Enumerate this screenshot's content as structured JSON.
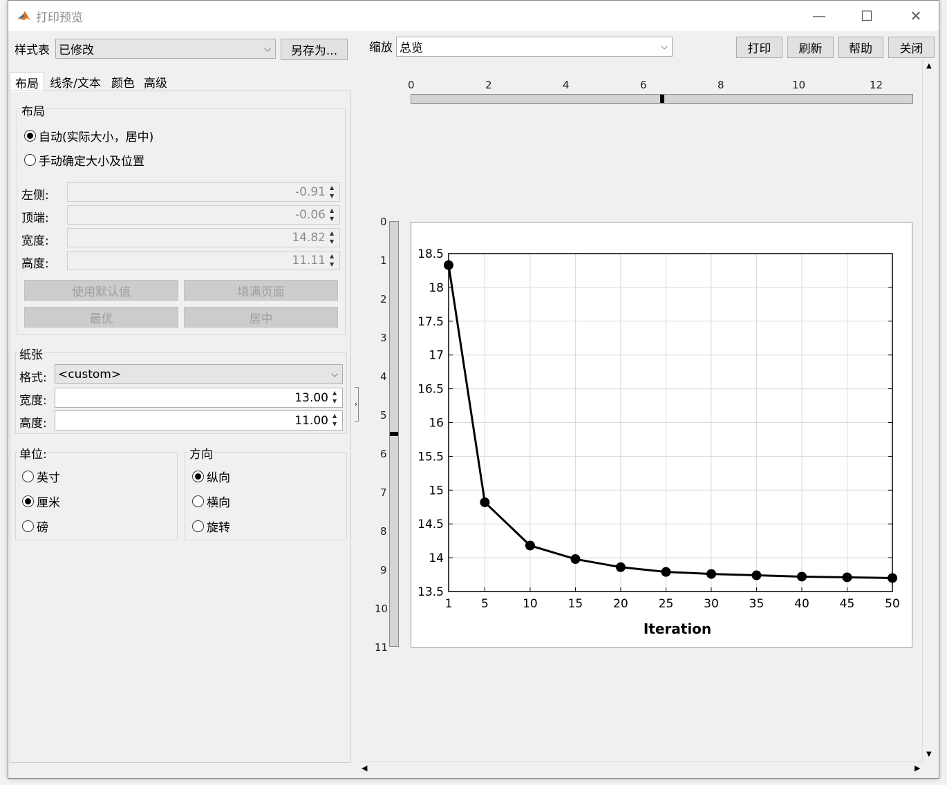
{
  "window": {
    "title": "打印预览"
  },
  "toolbar": {
    "stylesheet_label": "样式表",
    "stylesheet_value": "已修改",
    "save_as": "另存为...",
    "zoom_label": "缩放",
    "zoom_value": "总览",
    "print": "打印",
    "refresh": "刷新",
    "help": "帮助",
    "close": "关闭"
  },
  "tabs": [
    "布局",
    "线条/文本",
    "颜色",
    "高级"
  ],
  "layout": {
    "group_label": "布局",
    "auto_option": "自动(实际大小，居中)",
    "manual_option": "手动确定大小及位置",
    "left_label": "左侧:",
    "left_value": "-0.91",
    "top_label": "顶端:",
    "top_value": "-0.06",
    "width_label": "宽度:",
    "width_value": "14.82",
    "height_label": "高度:",
    "height_value": "11.11",
    "use_default": "使用默认值",
    "fill_page": "填满页面",
    "best": "最优",
    "center": "居中"
  },
  "paper": {
    "group_label": "纸张",
    "format_label": "格式:",
    "format_value": "<custom>",
    "width_label": "宽度:",
    "width_value": "13.00",
    "height_label": "高度:",
    "height_value": "11.00"
  },
  "units": {
    "group_label": "单位:",
    "inch": "英寸",
    "cm": "厘米",
    "pound": "磅",
    "selected": "cm"
  },
  "orientation": {
    "group_label": "方向",
    "portrait": "纵向",
    "landscape": "横向",
    "rotate": "旋转",
    "selected": "portrait"
  },
  "rulers": {
    "horizontal_ticks": [
      "0",
      "2",
      "4",
      "6",
      "8",
      "10",
      "12"
    ],
    "vertical_ticks": [
      "0",
      "1",
      "2",
      "3",
      "4",
      "5",
      "6",
      "7",
      "8",
      "9",
      "10",
      "11"
    ]
  },
  "colors": {
    "window_bg": "#f0f0f0",
    "plot_line": "#000000",
    "grid": "#d9d9d9"
  },
  "chart_data": {
    "type": "line",
    "title": "",
    "xlabel": "Iteration",
    "ylabel": "",
    "x": [
      1,
      5,
      10,
      15,
      20,
      25,
      30,
      35,
      40,
      45,
      50
    ],
    "series": [
      {
        "values": [
          18.33,
          14.82,
          14.18,
          13.98,
          13.86,
          13.79,
          13.76,
          13.74,
          13.72,
          13.71,
          13.7
        ]
      }
    ],
    "xticks": [
      "1",
      "5",
      "10",
      "15",
      "20",
      "25",
      "30",
      "35",
      "40",
      "45",
      "50"
    ],
    "yticks": [
      "13.5",
      "14",
      "14.5",
      "15",
      "15.5",
      "16",
      "16.5",
      "17",
      "17.5",
      "18",
      "18.5"
    ],
    "xlim": [
      1,
      50
    ],
    "ylim": [
      13.5,
      18.5
    ],
    "grid": true
  }
}
